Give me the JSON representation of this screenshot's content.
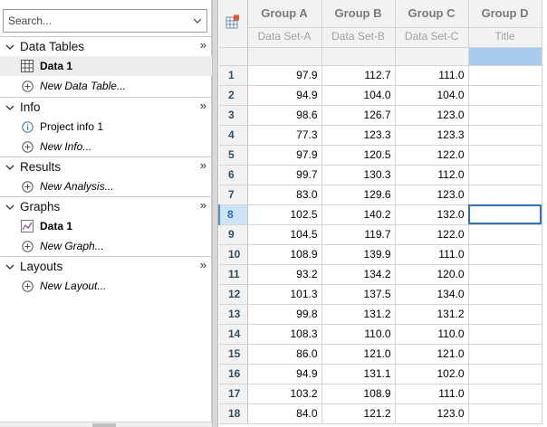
{
  "search": {
    "placeholder": "Search..."
  },
  "navigator": {
    "sections": [
      {
        "title": "Data Tables",
        "items": [
          {
            "label": "Data 1",
            "icon": "data-table-icon",
            "selected": true
          },
          {
            "label": "New Data Table...",
            "icon": "add-circle-icon",
            "new": true
          }
        ]
      },
      {
        "title": "Info",
        "items": [
          {
            "label": "Project info 1",
            "icon": "info-icon"
          },
          {
            "label": "New Info...",
            "icon": "add-circle-icon",
            "new": true
          }
        ]
      },
      {
        "title": "Results",
        "items": [
          {
            "label": "New Analysis...",
            "icon": "add-circle-icon",
            "new": true
          }
        ]
      },
      {
        "title": "Graphs",
        "items": [
          {
            "label": "Data 1",
            "icon": "graph-icon",
            "bold": true
          },
          {
            "label": "New Graph...",
            "icon": "add-circle-icon",
            "new": true
          }
        ]
      },
      {
        "title": "Layouts",
        "items": [
          {
            "label": "New Layout...",
            "icon": "add-circle-icon",
            "new": true
          }
        ]
      }
    ],
    "collapse_glyph": "»"
  },
  "sheet": {
    "columns": [
      {
        "group": "Group A",
        "dataset": "Data Set-A"
      },
      {
        "group": "Group B",
        "dataset": "Data Set-B"
      },
      {
        "group": "Group C",
        "dataset": "Data Set-C"
      },
      {
        "group": "Group D",
        "dataset": "Title"
      }
    ],
    "active_row": 8,
    "rows": [
      {
        "n": "1",
        "a": "97.9",
        "b": "112.7",
        "c": "111.0"
      },
      {
        "n": "2",
        "a": "94.9",
        "b": "104.0",
        "c": "104.0"
      },
      {
        "n": "3",
        "a": "98.6",
        "b": "126.7",
        "c": "123.0"
      },
      {
        "n": "4",
        "a": "77.3",
        "b": "123.3",
        "c": "123.3"
      },
      {
        "n": "5",
        "a": "97.9",
        "b": "120.5",
        "c": "122.0"
      },
      {
        "n": "6",
        "a": "99.7",
        "b": "130.3",
        "c": "112.0"
      },
      {
        "n": "7",
        "a": "83.0",
        "b": "129.6",
        "c": "123.0"
      },
      {
        "n": "8",
        "a": "102.5",
        "b": "140.2",
        "c": "132.0"
      },
      {
        "n": "9",
        "a": "104.5",
        "b": "119.7",
        "c": "122.0"
      },
      {
        "n": "10",
        "a": "108.9",
        "b": "139.9",
        "c": "111.0"
      },
      {
        "n": "11",
        "a": "93.2",
        "b": "134.2",
        "c": "120.0"
      },
      {
        "n": "12",
        "a": "101.3",
        "b": "137.5",
        "c": "134.0"
      },
      {
        "n": "13",
        "a": "99.8",
        "b": "131.2",
        "c": "131.2"
      },
      {
        "n": "14",
        "a": "108.3",
        "b": "110.0",
        "c": "110.0"
      },
      {
        "n": "15",
        "a": "86.0",
        "b": "121.0",
        "c": "121.0"
      },
      {
        "n": "16",
        "a": "94.9",
        "b": "131.1",
        "c": "102.0"
      },
      {
        "n": "17",
        "a": "103.2",
        "b": "108.9",
        "c": "111.0"
      },
      {
        "n": "18",
        "a": "84.0",
        "b": "121.2",
        "c": "123.0"
      }
    ]
  },
  "colors": {
    "selection": "#a9ccee",
    "active_row_bg": "#cfe3f6",
    "active_row_text": "#1e6fc4",
    "row_number_text": "#2b4f6a",
    "cursor_border": "#2f73b8"
  }
}
